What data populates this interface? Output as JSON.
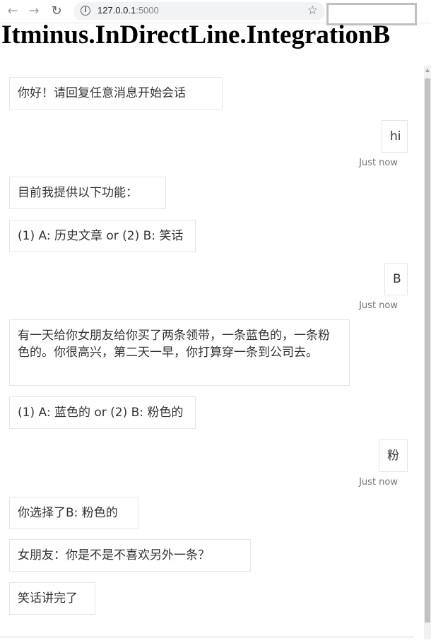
{
  "browser": {
    "url_host": "127.0.0.1",
    "url_port": ":5000"
  },
  "page": {
    "title": "Itminus.InDirectLine.IntegrationB"
  },
  "chat": {
    "messages": [
      {
        "from": "bot",
        "text": "你好！请回复任意消息开始会话"
      },
      {
        "from": "user",
        "text": "hi",
        "timestamp": "Just now"
      },
      {
        "from": "bot",
        "text": "目前我提供以下功能："
      },
      {
        "from": "bot",
        "text": "(1) A: 历史文章 or (2) B: 笑话"
      },
      {
        "from": "user",
        "text": "B",
        "timestamp": "Just now"
      },
      {
        "from": "bot",
        "text": "有一天给你女朋友给你买了两条领带，一条蓝色的，一条粉色的。你很高兴，第二天一早，你打算穿一条到公司去。"
      },
      {
        "from": "bot",
        "text": "(1) A: 蓝色的 or (2) B: 粉色的"
      },
      {
        "from": "user",
        "text": "粉",
        "timestamp": "Just now"
      },
      {
        "from": "bot",
        "text": "你选择了B: 粉色的"
      },
      {
        "from": "bot",
        "text": "女朋友：你是不是不喜欢另外一条？"
      },
      {
        "from": "bot",
        "text": "笑话讲完了"
      }
    ]
  }
}
